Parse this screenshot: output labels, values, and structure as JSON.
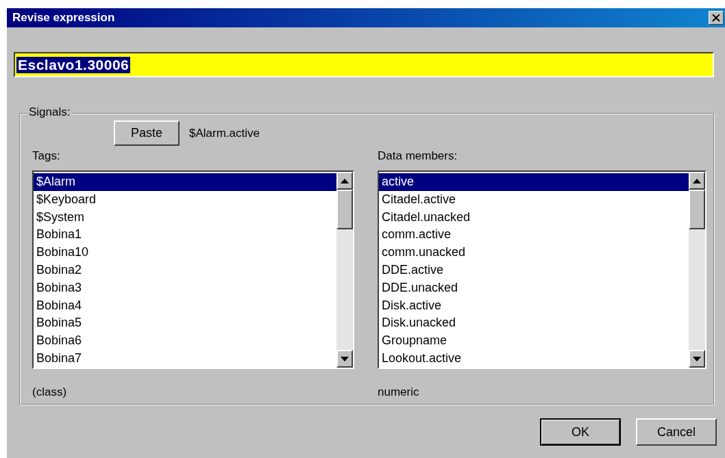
{
  "window": {
    "title": "Revise expression"
  },
  "expression": {
    "value": "Esclavo1.30006",
    "text_selected": true
  },
  "signals": {
    "legend": "Signals:",
    "paste_button": "Paste",
    "pasted_text": "$Alarm.active",
    "tags": {
      "label": "Tags:",
      "footer": "(class)",
      "items": [
        {
          "text": "$Alarm",
          "selected": true
        },
        {
          "text": "$Keyboard",
          "selected": false
        },
        {
          "text": "$System",
          "selected": false
        },
        {
          "text": "Bobina1",
          "selected": false
        },
        {
          "text": "Bobina10",
          "selected": false
        },
        {
          "text": "Bobina2",
          "selected": false
        },
        {
          "text": "Bobina3",
          "selected": false
        },
        {
          "text": "Bobina4",
          "selected": false
        },
        {
          "text": "Bobina5",
          "selected": false
        },
        {
          "text": "Bobina6",
          "selected": false
        },
        {
          "text": "Bobina7",
          "selected": false
        }
      ]
    },
    "members": {
      "label": "Data members:",
      "footer": "numeric",
      "items": [
        {
          "text": "active",
          "selected": true
        },
        {
          "text": "Citadel.active",
          "selected": false
        },
        {
          "text": "Citadel.unacked",
          "selected": false
        },
        {
          "text": "comm.active",
          "selected": false
        },
        {
          "text": "comm.unacked",
          "selected": false
        },
        {
          "text": "DDE.active",
          "selected": false
        },
        {
          "text": "DDE.unacked",
          "selected": false
        },
        {
          "text": "Disk.active",
          "selected": false
        },
        {
          "text": "Disk.unacked",
          "selected": false
        },
        {
          "text": "Groupname",
          "selected": false
        },
        {
          "text": "Lookout.active",
          "selected": false
        }
      ]
    }
  },
  "buttons": [
    "OK",
    "Cancel"
  ]
}
